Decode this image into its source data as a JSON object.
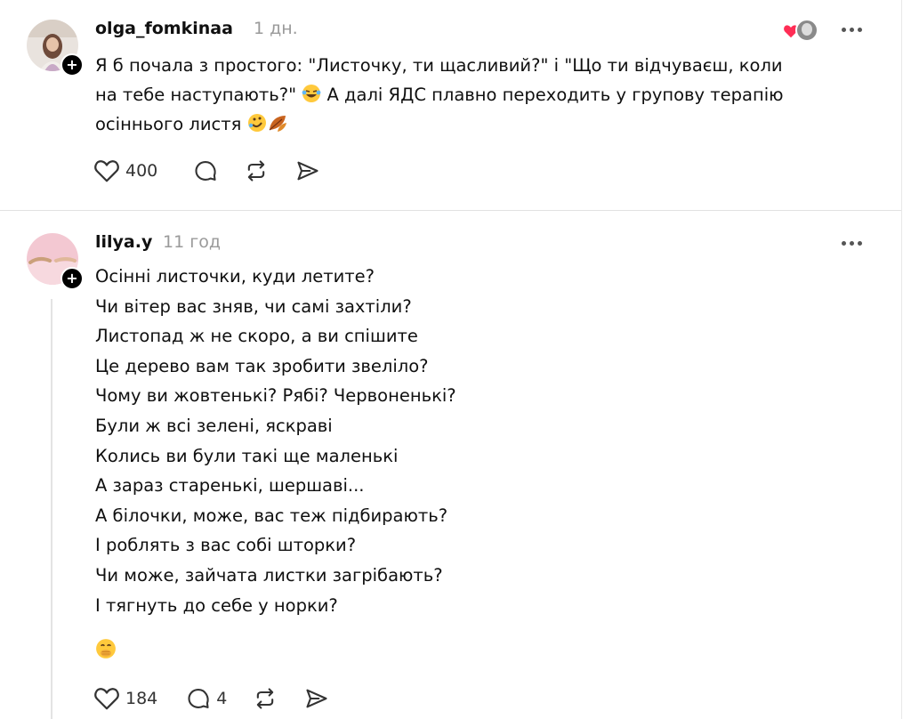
{
  "post1": {
    "username": "olga_fomkinaa",
    "time": "1 дн.",
    "lines": [
      "Я б почала з простого: \"Листочку, ти щасливий?\" і \"Що ти відчуваєш, коли",
      "на тебе наступають?\"",
      "А далі ЯДС плавно переходить у групову терапію",
      "осіннього листя"
    ],
    "likes": "400"
  },
  "post2": {
    "username": "lilya.y",
    "time": "11 год",
    "poem": [
      "Осінні листочки, куди летите?",
      "Чи вітер вас зняв, чи самі захтіли?",
      "Листопад ж не скоро, а ви спішите",
      "Це дерево вам так зробити звеліло?",
      "Чому ви жовтенькі? Рябі? Червоненькі?",
      "Були ж всі зелені, яскраві",
      "Колись ви були такі ще маленькі",
      "А зараз старенькі, шершаві...",
      "А білочки, може, вас теж підбирають?",
      "І роблять з вас собі шторки?",
      "Чи може, зайчата листки загрібають?",
      "І тягнуть до себе у норки?"
    ],
    "likes": "184",
    "replies": "4"
  },
  "colors": {
    "heart_red": "#ff2d55",
    "muted": "#9a9a9a",
    "text": "#101010"
  }
}
